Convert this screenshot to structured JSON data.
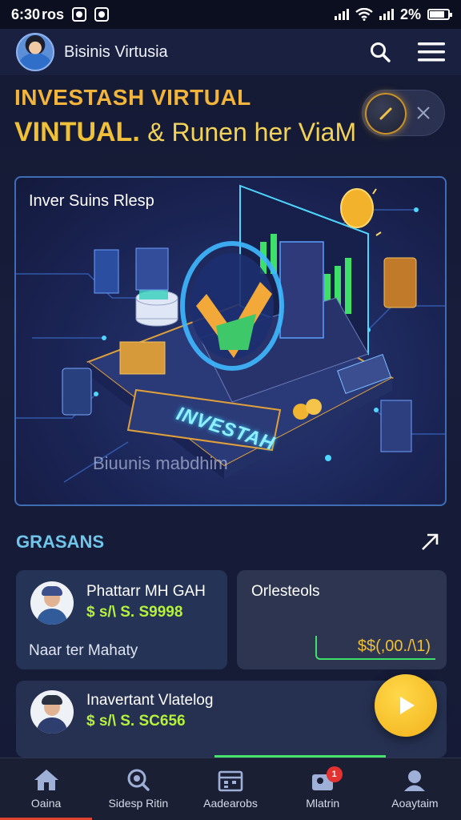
{
  "status_bar": {
    "time": "6:30",
    "carrier_text": "ros",
    "battery": "2%"
  },
  "app_bar": {
    "title": "Bisinis Virtusia"
  },
  "hero": {
    "line1": "INVESTASH VIRTUAL",
    "line2_main": "VINTUAL.",
    "line2_sub": "& Runen her ViaM"
  },
  "illustration": {
    "caption": "Inver Suins Rlesp",
    "brand_text": "INVESTAH",
    "watermark": "Biuunis mabdhim"
  },
  "section": {
    "title": "GRASANS"
  },
  "cards": [
    {
      "name": "Phattarr MH GAH",
      "value": "$ s/\\ S. S9998",
      "note": "Naar ter Mahaty"
    },
    {
      "name": "Orlesteols",
      "amount": "$$(,00./\\1)"
    },
    {
      "name": "Inavertant Vlatelog",
      "value": "$ s/\\ S. SC656"
    }
  ],
  "bottom_nav": [
    {
      "label": "Oaina",
      "icon": "home-icon"
    },
    {
      "label": "Sidesp Ritin",
      "icon": "search-icon"
    },
    {
      "label": "Aadearobs",
      "icon": "calendar-icon"
    },
    {
      "label": "Mlatrin",
      "icon": "notification-icon",
      "badge": "1"
    },
    {
      "label": "Aoaytaim",
      "icon": "profile-icon"
    }
  ],
  "colors": {
    "accent_gold": "#f0c038",
    "section_blue": "#6fc6ea",
    "value_green": "#b5f23a",
    "active_tab": "#e0442f"
  }
}
